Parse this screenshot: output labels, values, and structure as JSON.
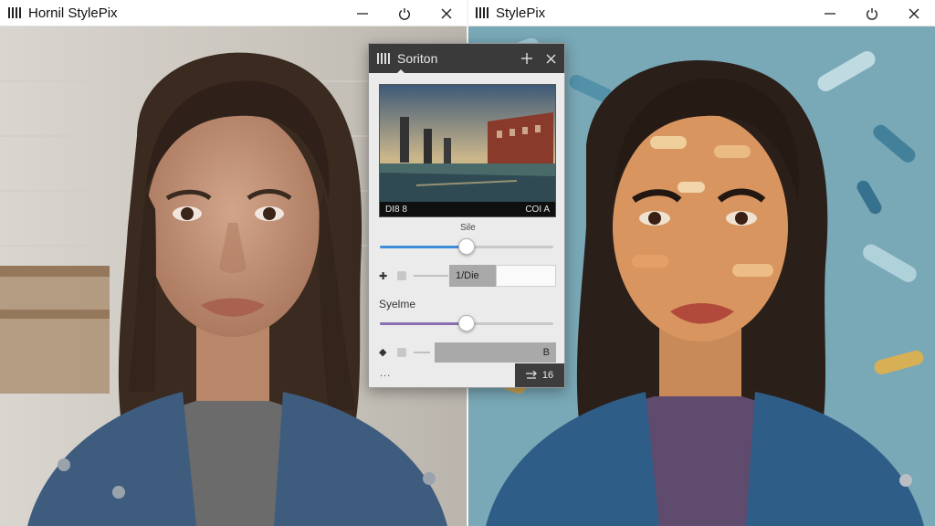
{
  "left_window": {
    "title": "Hornil StylePix"
  },
  "right_window": {
    "title": "StylePix"
  },
  "window_buttons": {
    "minimize_icon": "minimize-icon",
    "restore_icon": "power-icon",
    "close_icon": "close-icon"
  },
  "panel": {
    "title": "Soriton",
    "preview": {
      "left_text": "DI8 8",
      "right_text": "COI A"
    },
    "size_label": "Sile",
    "size_slider_value": 0.5,
    "size_field_value": "1/Die",
    "style_label": "Syelme",
    "style_slider_value": 0.5,
    "style_field_value": "B",
    "footer_button_label": "16",
    "more_label": "..."
  },
  "colors": {
    "slider_blue": "#3f8fd8",
    "slider_purple": "#8a6fb1",
    "panel_title_bg": "#3a3a3a"
  }
}
